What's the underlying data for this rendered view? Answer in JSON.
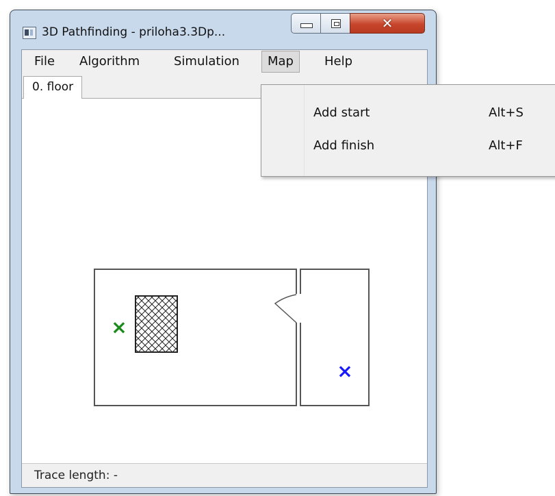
{
  "window": {
    "title": "3D Pathfinding - priloha3.3Dp...",
    "buttons": {
      "minimize": "minimize",
      "maximize": "maximize",
      "close": "✕"
    }
  },
  "menu": {
    "items": [
      {
        "label": "File"
      },
      {
        "label": "Algorithm"
      },
      {
        "label": "Simulation"
      },
      {
        "label": "Map"
      },
      {
        "label": "Help"
      }
    ],
    "open_menu": "Map",
    "dropdown": [
      {
        "label": "Add start",
        "shortcut": "Alt+S"
      },
      {
        "label": "Add finish",
        "shortcut": "Alt+F"
      }
    ]
  },
  "tabs": [
    {
      "label": "0. floor"
    }
  ],
  "map": {
    "start_marker": "×",
    "finish_marker": "×",
    "colors": {
      "start": "#1a8a1a",
      "finish": "#1a1aff",
      "wall": "#555555",
      "obstacle_hatch": "#222222"
    }
  },
  "status": {
    "text": "Trace length: -"
  },
  "colors": {
    "title_bar": "#c9d9ec",
    "close_button": "#c8452b",
    "menu_bg": "#f0f0f0"
  }
}
